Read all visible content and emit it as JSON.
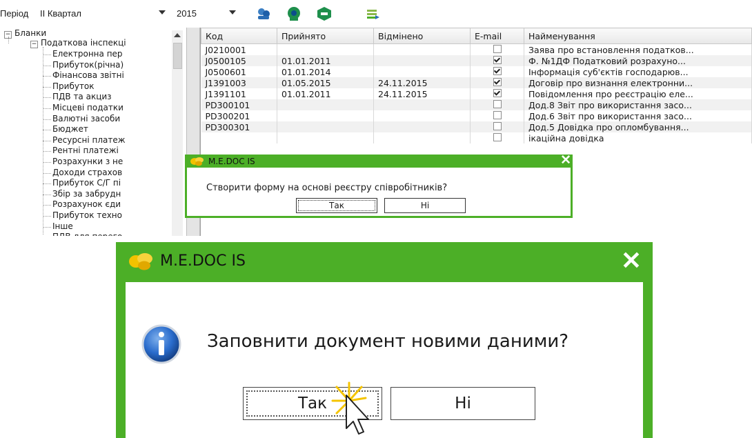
{
  "toolbar": {
    "period_label": "Період",
    "quarter_value": "ІІ Квартал",
    "year_value": "2015",
    "buttons": [
      "people-icon",
      "key-icon",
      "shield-icon",
      "export-icon"
    ]
  },
  "tree": {
    "root": "Бланки",
    "node": "Податкова інспекці",
    "items": [
      "Електронна пер",
      "Прибуток(річна)",
      "Фінансова звітні",
      "Прибуток",
      "ПДВ та акциз",
      "Місцеві податки",
      "Валютні засоби",
      "Бюджет",
      "Ресурсні платеж",
      "Рентні платежі",
      "Розрахунки з не",
      "Доходи страхов",
      "Прибуток С/Г пі",
      "Збір за забрудн",
      "Розрахунок єди",
      "Прибуток техно",
      "Інше",
      "ПДВ для перего"
    ]
  },
  "grid": {
    "columns": [
      "Код",
      "Прийнято",
      "Відмінено",
      "E-mail",
      "Найменування"
    ],
    "rows": [
      {
        "code": "J0210001",
        "accepted": "",
        "cancelled": "",
        "email": false,
        "name": "Заява про встановлення податков..."
      },
      {
        "code": "J0500105",
        "accepted": "01.01.2011",
        "cancelled": "",
        "email": true,
        "name": "Ф. №1ДФ Податковий розрахуно..."
      },
      {
        "code": "J0500601",
        "accepted": "01.01.2014",
        "cancelled": "",
        "email": true,
        "name": "Інформація суб'єктів господарюв..."
      },
      {
        "code": "J1391003",
        "accepted": "01.05.2015",
        "cancelled": "24.11.2015",
        "email": true,
        "name": "Договір про визнання електронни..."
      },
      {
        "code": "J1391101",
        "accepted": "01.01.2011",
        "cancelled": "24.11.2015",
        "email": true,
        "name": "Повідомлення про реєстрацію еле..."
      },
      {
        "code": "PD300101",
        "accepted": "",
        "cancelled": "",
        "email": false,
        "name": "Дод.8 Звіт про використання засо..."
      },
      {
        "code": "PD300201",
        "accepted": "",
        "cancelled": "",
        "email": false,
        "name": "Дод.6 Звіт про використання засо..."
      },
      {
        "code": "PD300301",
        "accepted": "",
        "cancelled": "",
        "email": false,
        "name": "Дод.5 Довідка про опломбування..."
      },
      {
        "code": "",
        "accepted": "",
        "cancelled": "",
        "email": false,
        "name": "ікаційна довідка"
      }
    ]
  },
  "dialog_small": {
    "title": "M.E.DOC IS",
    "message": "Створити форму на основі реєстру співробітників?",
    "yes": "Так",
    "no": "Ні"
  },
  "dialog_big": {
    "title": "M.E.DOC IS",
    "message": "Заповнити документ новими даними?",
    "yes": "Так",
    "no": "Ні"
  },
  "colors": {
    "dialog_frame": "#4caf27",
    "info_icon": "#1f5fb8",
    "click_spark": "#f5c400"
  }
}
